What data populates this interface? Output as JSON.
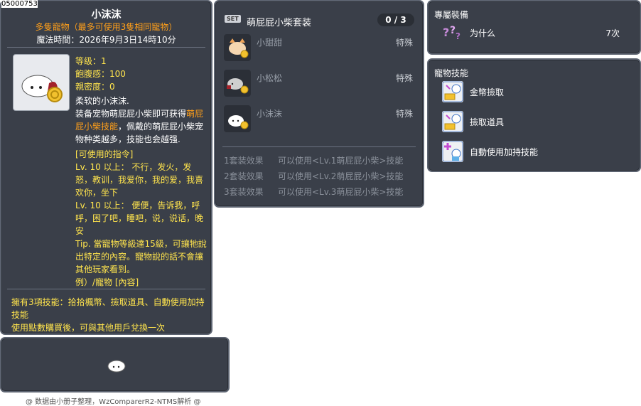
{
  "item_id": "05000753",
  "item": {
    "name": "小沫沫",
    "subtitle": "多隻寵物（最多可使用3隻相同寵物）",
    "magic_time": "魔法時間：2026年9月3日14時10分",
    "stats": {
      "level": "等级：1",
      "fullness": "飽腹感：100",
      "closeness": "親密度：0"
    },
    "desc_1": "柔软的小沫沫.",
    "desc_2a": "装备宠物萌屁屁小柴即可获得",
    "desc_2b": "萌屁屁小柴技能",
    "desc_2c": "，佩戴的萌屁屁小柴宠物种类越多，技能也会越强.",
    "commands": [
      "[可使用的指令]",
      "Lv. 10 以上： 不行，发火，发怒，教训，我爱你，我的爱，我喜欢你，坐下",
      "Lv. 10 以上： 便便，告诉我，呼呼，困了吧，睡吧，说，说话，晚安",
      "Tip. 當寵物等級達15級，可讓牠說出特定的內容。寵物說的話不會讓其他玩家看到。",
      "例）/寵物 [內容]"
    ],
    "skill_note": "擁有3項技能：拾拾楓幣、撿取道具、自動使用加持技能",
    "trade_note": "使用點數購買後，可與其他用戶兌換一次"
  },
  "footer": "@ 数据由小册子整理，WzComparerR2-NTMS解析 @",
  "set": {
    "badge": "SET",
    "name": "萌屁屁小柴套装",
    "count": "0 / 3",
    "members": [
      {
        "name": "小甜甜",
        "type": "特殊"
      },
      {
        "name": "小松松",
        "type": "特殊"
      },
      {
        "name": "小沫沫",
        "type": "特殊"
      }
    ],
    "effects": [
      {
        "label": "1套装效果",
        "text": "可以使用<Lv.1萌屁屁小柴>技能"
      },
      {
        "label": "2套装效果",
        "text": "可以使用<Lv.2萌屁屁小柴>技能"
      },
      {
        "label": "3套装效果",
        "text": "可以使用<Lv.3萌屁屁小柴>技能"
      }
    ]
  },
  "exclusive": {
    "title": "專屬裝備",
    "item_name": "为什么",
    "item_count": "7次"
  },
  "pet_skills": {
    "title": "寵物技能",
    "skills": [
      "金幣撿取",
      "撿取道具",
      "自動使用加持技能"
    ]
  }
}
